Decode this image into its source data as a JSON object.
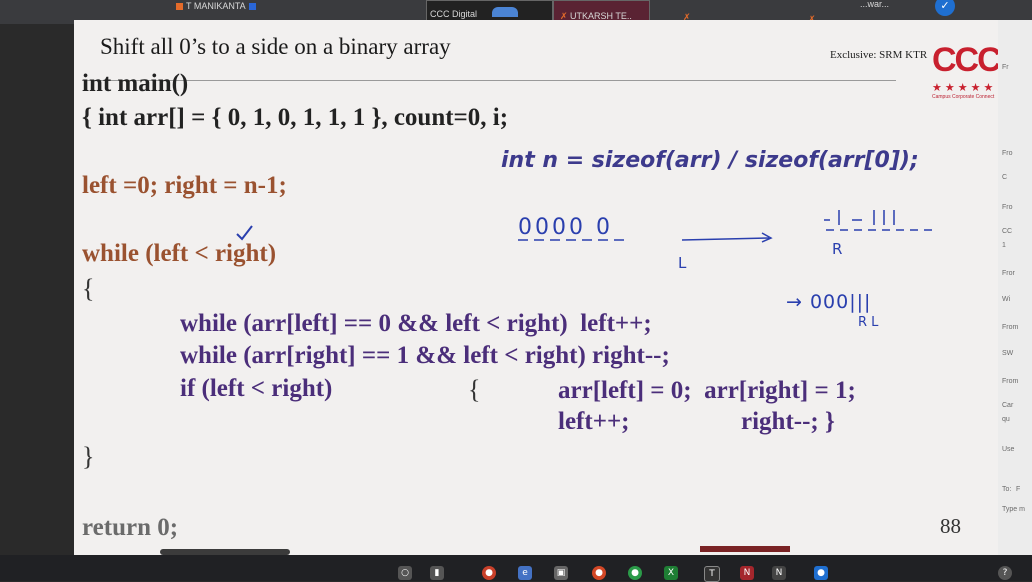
{
  "taskbar_top": {
    "participant_name": "T MANIKANTA",
    "thumb_label": "CCC Digital",
    "participant_2": "UTKARSH TE..",
    "right_text": "...war..."
  },
  "slide": {
    "title": "Shift all 0’s to a side on a binary array",
    "exclusive": "Exclusive: SRM KTR",
    "logo_text": "CCC",
    "logo_stars": "★★★★★",
    "logo_sub": "Campus Corporate Connect",
    "code": {
      "line1": "int main()",
      "line2": "{ int arr[] = { 0, 1, 0, 1, 1, 1 }, count=0, i;",
      "line3": "int n = sizeof(arr) / sizeof(arr[0]);",
      "line4": "left =0; right = n-1;",
      "line5": "while (left < right)",
      "open_brace": "{",
      "line6": "while (arr[left] == 0 && left < right)  left++;",
      "line7": "while (arr[right] == 1 && left < right) right--;",
      "line8": "if (left < right)",
      "line8_brace": "{",
      "line8b": "arr[left] = 0;  arr[right] = 1;",
      "line9a": "left++;",
      "line9b": "right--; }",
      "close_brace": "}",
      "line10": "return 0;"
    },
    "annotations": {
      "zeros": "0000  0",
      "r_mark": "R",
      "l_mark": "L",
      "result": "→ 000|||",
      "rl_mark": "R L"
    },
    "page_number": "88"
  },
  "side_panel": {
    "items": [
      "Fr",
      "Fro",
      "C",
      "Fro",
      "CC",
      "1",
      "Fror",
      "Wi",
      "From",
      "SW",
      "From",
      "Car",
      "qu",
      "Use",
      "To:",
      "F",
      "Type m"
    ]
  },
  "colors": {
    "slide_bg": "#f2f0ef",
    "code_black": "#222222",
    "code_brown": "#9a5230",
    "code_purple": "#4b2e7a",
    "code_blue": "#3d3a8c",
    "ink_blue": "#2a3fae",
    "logo_red": "#c8202e"
  }
}
